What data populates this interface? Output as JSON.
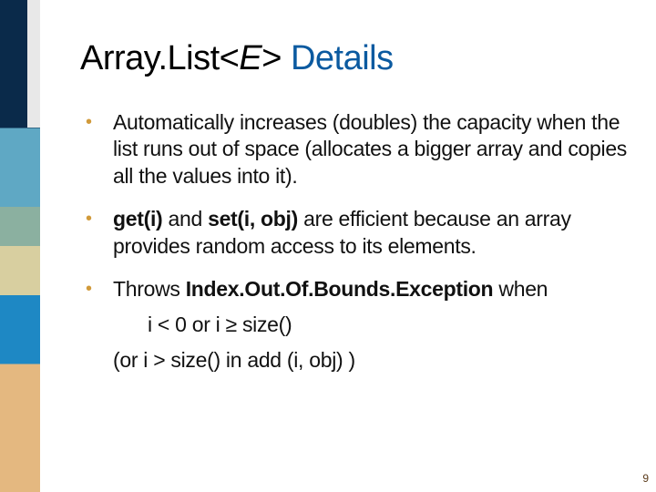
{
  "title": {
    "prefix": "Array.List<",
    "generic": "E",
    "suffix": "> ",
    "word": "Details"
  },
  "bullets": [
    {
      "text": "Automatically increases (doubles) the capacity when the list runs out of space (allocates a bigger array and copies all the values into it)."
    },
    {
      "b1": "get(i)",
      "mid1": " and ",
      "b2": "set(i, obj)",
      "tail": " are efficient because an array provides random access to its elements."
    },
    {
      "lead": "Throws ",
      "bold": "Index.Out.Of.Bounds.Exception",
      "tail": " when",
      "sub1": "i < 0 or i ≥ size()",
      "sub2": "(or i > size() in add (i, obj) )"
    }
  ],
  "page_number": "9"
}
